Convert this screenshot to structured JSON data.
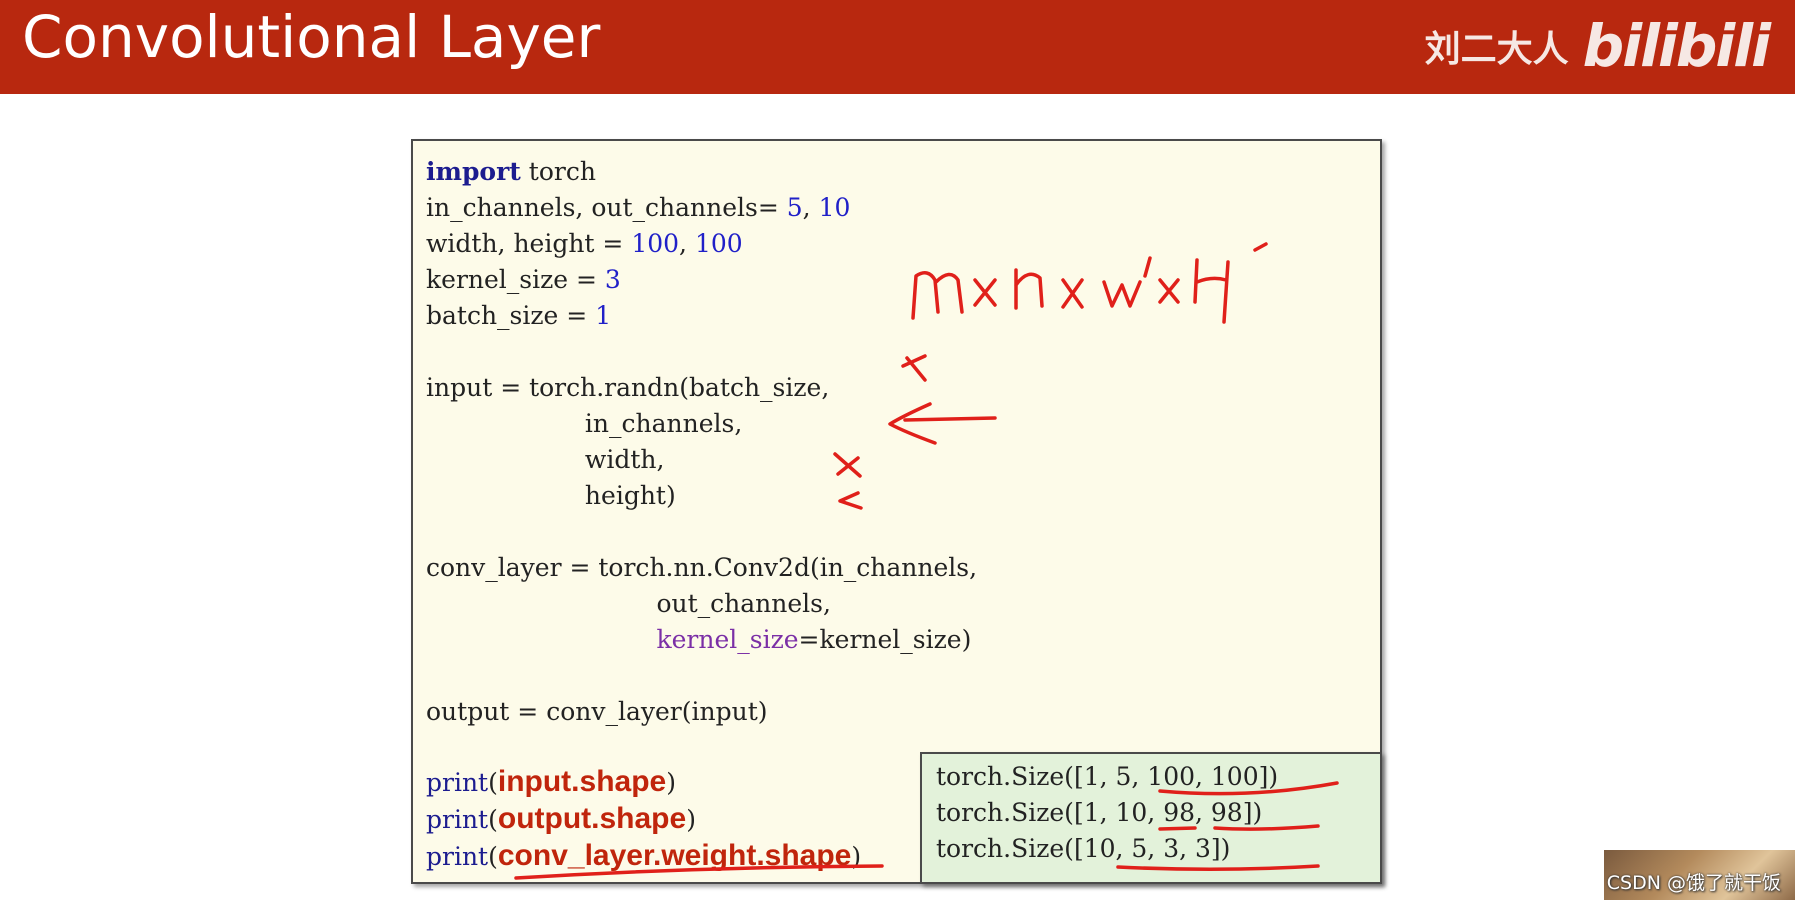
{
  "header": {
    "title": "Convolutional Layer",
    "author": "刘二大人",
    "logo_text": "bilibili"
  },
  "code": {
    "line1_kw": "import",
    "line1_rest": " torch",
    "line2_a": "in_channels, out_channels= ",
    "line2_n1": "5",
    "line2_b": ", ",
    "line2_n2": "10",
    "line3_a": "width, height = ",
    "line3_n1": "100",
    "line3_b": ", ",
    "line3_n2": "100",
    "line4_a": "kernel_size = ",
    "line4_n": "3",
    "line5_a": "batch_size = ",
    "line5_n": "1",
    "input_1": "input = torch.randn(batch_size,",
    "input_2": "                    in_channels,",
    "input_3": "                    width,",
    "input_4": "                    height)",
    "conv_1": "conv_layer = torch.nn.Conv2d(in_channels,",
    "conv_2": "                             out_channels,",
    "conv_3_indent": "                             ",
    "conv_3_kwarg": "kernel_size",
    "conv_3_rest": "=kernel_size)",
    "output_line": "output = conv_layer(input)",
    "print_fn": "print",
    "print1_arg": "input.shape",
    "print2_arg": "output.shape",
    "print3_arg": "conv_layer.weight.shape",
    "open_paren": "(",
    "close_paren": ")"
  },
  "output": {
    "line1": "torch.Size([1, 5, 100, 100])",
    "line2": "torch.Size([1, 10, 98, 98])",
    "line3": "torch.Size([10, 5, 3, 3])"
  },
  "handwriting": {
    "note": "m×n×w'×h'",
    "color": "#e0201a"
  },
  "watermark": "CSDN @饿了就干饭",
  "colors": {
    "header_bg": "#b8280f",
    "code_bg": "#fdfbe9",
    "output_bg": "#e3f2da",
    "highlight_red": "#c0250c"
  }
}
